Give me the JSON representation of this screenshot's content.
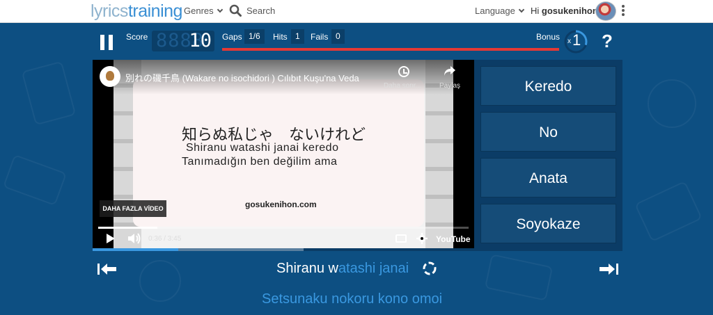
{
  "header": {
    "logo_main": "lyrics",
    "logo_accent": "training",
    "genres_label": "Genres",
    "search_label": "Search",
    "language_label": "Language",
    "greeting_prefix": "Hi ",
    "username": "gosukenihon!"
  },
  "game": {
    "score_label": "Score",
    "score_ghost": "8888",
    "score_value": "10",
    "gaps_label": "Gaps",
    "gaps_value": "1/6",
    "hits_label": "Hits",
    "hits_value": "1",
    "fails_label": "Fails",
    "fails_value": "0",
    "bonus_label": "Bonus",
    "bonus_multiplier_prefix": "x",
    "bonus_value": "1",
    "bonus_progress": 0.3,
    "help_label": "?"
  },
  "video": {
    "title": "別れの磯千鳥 (Wakare no isochidori ) Cılıbıt Kuşu'na Veda",
    "lyric_jp": "知らぬ私じゃ　ないけれど",
    "lyric_romaji": "Shiranu watashi janai keredo",
    "lyric_translation": "Tanımadığın ben değilim ama",
    "watermark": "gosukenihon.com",
    "watch_later_label": "Daha sonr...",
    "share_label": "Paylaş",
    "more_videos_label": "DAHA FAZLA VİDEO",
    "time": "0:36 / 3:45",
    "progress": 0.16,
    "youtube_label": "YouTube"
  },
  "answers": [
    "Keredo",
    "No",
    "Anata",
    "Soyokaze"
  ],
  "lyrics": {
    "current_typed": "Shiranu w",
    "current_gap": "atashi janai",
    "next": "Setsunaku nokoru kono omoi"
  },
  "playback": {
    "progress": 0.162
  },
  "colors": {
    "background": "#0d4f82",
    "accent_blue": "#3a98e0",
    "progress_red": "#e53935"
  }
}
